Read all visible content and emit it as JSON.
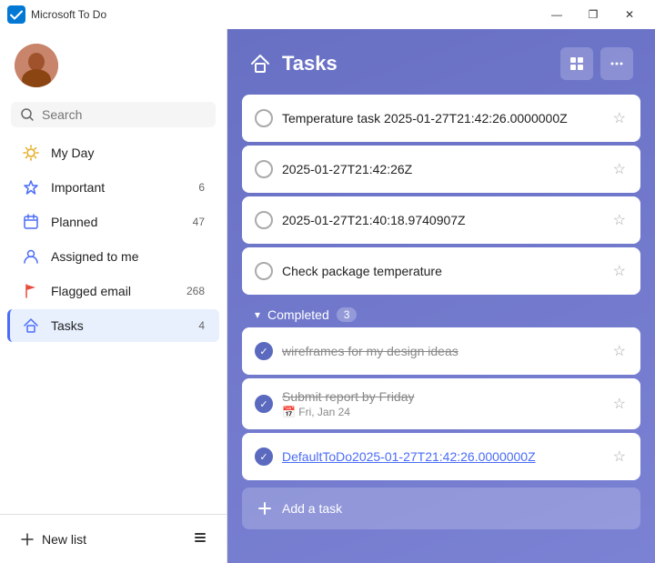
{
  "titleBar": {
    "appName": "Microsoft To Do",
    "controls": [
      "—",
      "❐",
      "✕"
    ]
  },
  "sidebar": {
    "searchPlaceholder": "Search",
    "navItems": [
      {
        "id": "my-day",
        "icon": "☀️",
        "label": "My Day",
        "count": null,
        "active": false
      },
      {
        "id": "important",
        "icon": "⭐",
        "label": "Important",
        "count": "6",
        "active": false
      },
      {
        "id": "planned",
        "icon": "📅",
        "label": "Planned",
        "count": "47",
        "active": false
      },
      {
        "id": "assigned-to-me",
        "icon": "👤",
        "label": "Assigned to me",
        "count": null,
        "active": false
      },
      {
        "id": "flagged-email",
        "icon": "🚩",
        "label": "Flagged email",
        "count": "268",
        "active": false
      },
      {
        "id": "tasks",
        "icon": "🏠",
        "label": "Tasks",
        "count": "4",
        "active": true
      }
    ],
    "newListLabel": "New list"
  },
  "main": {
    "title": "Tasks",
    "tasks": [
      {
        "id": 1,
        "label": "Temperature task 2025-01-27T21:42:26.0000000Z",
        "completed": false,
        "starred": false,
        "sub": null,
        "link": false
      },
      {
        "id": 2,
        "label": "2025-01-27T21:42:26Z",
        "completed": false,
        "starred": false,
        "sub": null,
        "link": false
      },
      {
        "id": 3,
        "label": "2025-01-27T21:40:18.9740907Z",
        "completed": false,
        "starred": false,
        "sub": null,
        "link": false
      },
      {
        "id": 4,
        "label": "Check package temperature",
        "completed": false,
        "starred": false,
        "sub": null,
        "link": false
      }
    ],
    "completedSection": {
      "label": "Completed",
      "count": "3",
      "items": [
        {
          "id": 5,
          "label": "wireframes for my design ideas",
          "completed": true,
          "starred": false,
          "sub": null,
          "link": false
        },
        {
          "id": 6,
          "label": "Submit report by Friday",
          "completed": true,
          "starred": false,
          "sub": "📅 Fri, Jan 24",
          "link": false
        },
        {
          "id": 7,
          "label": "DefaultToDo2025-01-27T21:42:26.0000000Z",
          "completed": true,
          "starred": false,
          "sub": null,
          "link": true
        }
      ]
    },
    "addTaskLabel": "Add a task"
  }
}
